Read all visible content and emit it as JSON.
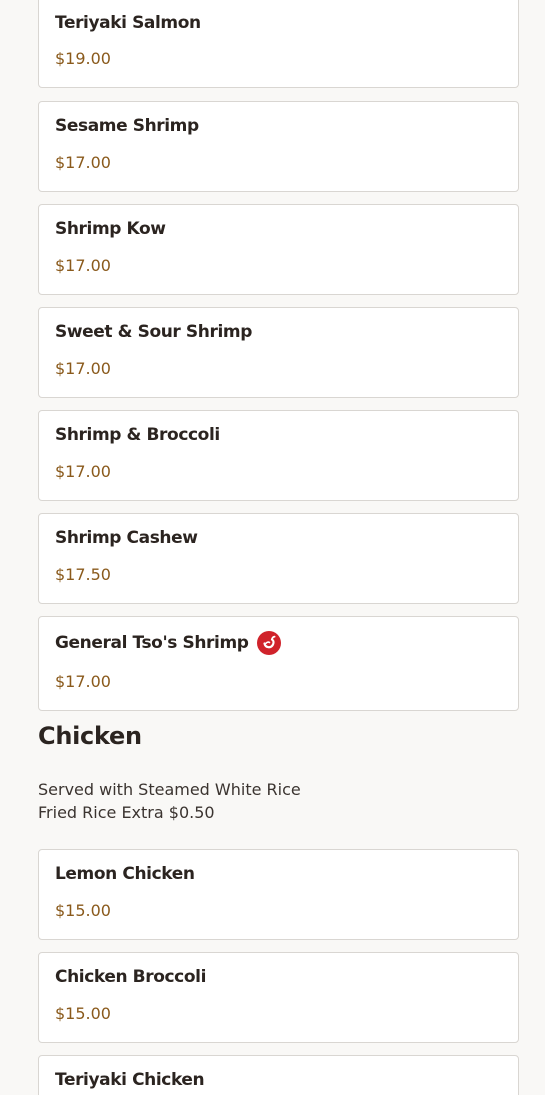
{
  "items_top": [
    {
      "name": "Teriyaki Salmon",
      "price": "$19.00"
    },
    {
      "name": "Sesame Shrimp",
      "price": "$17.00"
    },
    {
      "name": "Shrimp Kow",
      "price": "$17.00"
    },
    {
      "name": "Sweet & Sour Shrimp",
      "price": "$17.00"
    },
    {
      "name": "Shrimp & Broccoli",
      "price": "$17.00"
    },
    {
      "name": "Shrimp Cashew",
      "price": "$17.50"
    },
    {
      "name": "General Tso's Shrimp",
      "price": "$17.00",
      "icon": "spicy-pepper-icon"
    }
  ],
  "chicken_section": {
    "title": "Chicken",
    "description_lines": [
      "Served with Steamed White Rice",
      "Fried Rice Extra $0.50"
    ],
    "items": [
      {
        "name": "Lemon Chicken",
        "price": "$15.00"
      },
      {
        "name": "Chicken Broccoli",
        "price": "$15.00"
      },
      {
        "name": "Teriyaki Chicken",
        "price": ""
      }
    ]
  },
  "colors": {
    "background": "#f9f8f6",
    "card_border": "#d9d6d2",
    "price_text": "#8a5a1c",
    "spicy_icon": "#d0232b"
  }
}
